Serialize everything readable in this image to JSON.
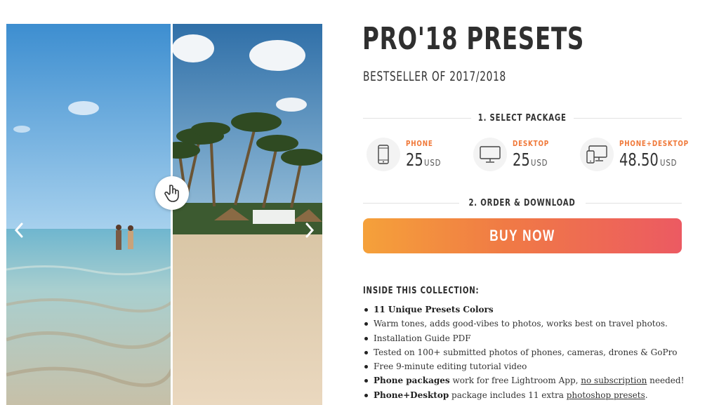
{
  "product": {
    "title": "PRO'18 PRESETS",
    "subtitle": "BESTSELLER OF 2017/2018"
  },
  "slider": {
    "left_arrow_icon": "chevron-left-icon",
    "right_arrow_icon": "chevron-right-icon",
    "handle_icon": "hand-pointer-icon"
  },
  "select_package": {
    "heading": "1. SELECT PACKAGE",
    "packages": [
      {
        "name": "PHONE",
        "price": "25",
        "currency": "USD",
        "icon": "phone-icon"
      },
      {
        "name": "DESKTOP",
        "price": "25",
        "currency": "USD",
        "icon": "desktop-icon"
      },
      {
        "name": "PHONE+DESKTOP",
        "price": "48.50",
        "currency": "USD",
        "icon": "phone-desktop-icon"
      }
    ]
  },
  "order": {
    "heading": "2. ORDER & DOWNLOAD",
    "buy_label": "BUY NOW"
  },
  "collection": {
    "heading": "INSIDE THIS COLLECTION:",
    "f1_bold": "11 Unique Presets Colors",
    "f2": "Warm tones, adds good-vibes to photos, works best on travel photos.",
    "f3": "Installation Guide PDF",
    "f4": "Tested on 100+ submitted photos of phones, cameras, drones & GoPro",
    "f5": "Free 9-minute editing tutorial video",
    "f6_bold": "Phone packages",
    "f6_text": " work for free Lightroom App, ",
    "f6_link": "no subscription",
    "f6_tail": " needed!",
    "f7_bold": "Phone+Desktop",
    "f7_text": " package includes 11 extra ",
    "f7_link": "photoshop presets",
    "f7_tail": "."
  },
  "colors": {
    "accent_orange": "#f07838",
    "button_gradient_start": "#f5a13a",
    "button_gradient_end": "#ec5a62"
  }
}
